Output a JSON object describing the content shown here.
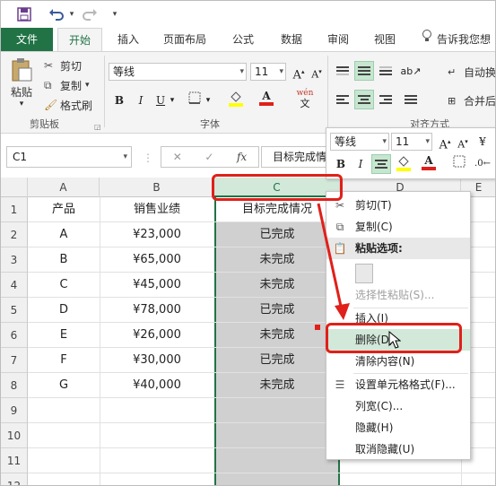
{
  "colors": {
    "accent": "#217346",
    "annotation": "#e0201a",
    "selection": "#d0d0d0",
    "menu_highlight": "#d2e8d9"
  },
  "qat": {
    "save_icon": "save-icon",
    "undo_icon": "undo-icon",
    "redo_icon": "redo-icon",
    "customize_icon": "chevron-down-icon"
  },
  "tabs": [
    "文件",
    "开始",
    "插入",
    "页面布局",
    "公式",
    "数据",
    "审阅",
    "视图"
  ],
  "tell_me": "告诉我您想",
  "ribbon": {
    "clipboard": {
      "paste": "粘贴",
      "cut": "剪切",
      "copy": "复制",
      "format_painter": "格式刷",
      "group_label": "剪贴板"
    },
    "font": {
      "name": "等线",
      "size": "11",
      "bold": "B",
      "italic": "I",
      "underline": "U",
      "group_label": "字体",
      "wen": "wén",
      "wen_char": "文"
    },
    "alignment": {
      "wrap": "自动换",
      "merge": "合并后",
      "group_label": "对齐方式"
    }
  },
  "formula_bar": {
    "name_box": "C1",
    "fx": "fx",
    "formula": "目标完成情况"
  },
  "columns": [
    "A",
    "B",
    "C",
    "D",
    "E"
  ],
  "rows": [
    {
      "num": "1",
      "a": "产品",
      "b": "销售业绩",
      "c": "目标完成情况"
    },
    {
      "num": "2",
      "a": "A",
      "b": "¥23,000",
      "c": "已完成"
    },
    {
      "num": "3",
      "a": "B",
      "b": "¥65,000",
      "c": "未完成"
    },
    {
      "num": "4",
      "a": "C",
      "b": "¥45,000",
      "c": "未完成"
    },
    {
      "num": "5",
      "a": "D",
      "b": "¥78,000",
      "c": "已完成"
    },
    {
      "num": "6",
      "a": "E",
      "b": "¥26,000",
      "c": "未完成"
    },
    {
      "num": "7",
      "a": "F",
      "b": "¥30,000",
      "c": "已完成"
    },
    {
      "num": "8",
      "a": "G",
      "b": "¥40,000",
      "c": "未完成"
    },
    {
      "num": "9",
      "a": "",
      "b": "",
      "c": ""
    },
    {
      "num": "10",
      "a": "",
      "b": "",
      "c": ""
    },
    {
      "num": "11",
      "a": "",
      "b": "",
      "c": ""
    },
    {
      "num": "12",
      "a": "",
      "b": "",
      "c": ""
    }
  ],
  "mini_toolbar": {
    "font": "等线",
    "size": "11",
    "bold": "B",
    "italic": "I"
  },
  "context_menu": {
    "cut": "剪切(T)",
    "copy": "复制(C)",
    "paste_options": "粘贴选项:",
    "paste_special": "选择性粘贴(S)...",
    "insert": "插入(I)",
    "delete": "删除(D)",
    "clear": "清除内容(N)",
    "format_cells": "设置单元格格式(F)...",
    "col_width": "列宽(C)...",
    "hide": "隐藏(H)",
    "unhide": "取消隐藏(U)"
  }
}
